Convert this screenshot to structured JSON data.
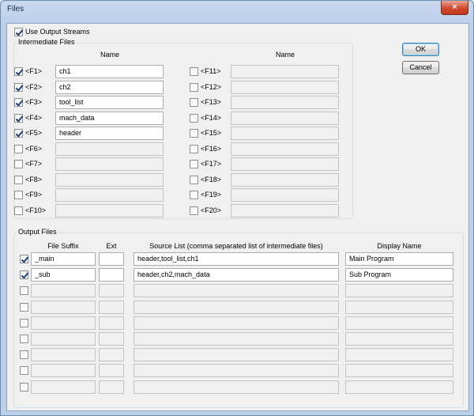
{
  "window": {
    "title": "Files",
    "close_glyph": "×"
  },
  "use_output_streams": {
    "label": "Use Output Streams",
    "checked": true
  },
  "intermediate": {
    "group_title": "Intermediate Files",
    "name_header_left": "Name",
    "name_header_right": "Name",
    "items": [
      {
        "label": "<F1>",
        "value": "ch1",
        "checked": true
      },
      {
        "label": "<F2>",
        "value": "ch2",
        "checked": true
      },
      {
        "label": "<F3>",
        "value": "tool_list",
        "checked": true
      },
      {
        "label": "<F4>",
        "value": "mach_data",
        "checked": true
      },
      {
        "label": "<F5>",
        "value": "header",
        "checked": true
      },
      {
        "label": "<F6>",
        "value": "",
        "checked": false
      },
      {
        "label": "<F7>",
        "value": "",
        "checked": false
      },
      {
        "label": "<F8>",
        "value": "",
        "checked": false
      },
      {
        "label": "<F9>",
        "value": "",
        "checked": false
      },
      {
        "label": "<F10>",
        "value": "",
        "checked": false
      },
      {
        "label": "<F11>",
        "value": "",
        "checked": false
      },
      {
        "label": "<F12>",
        "value": "",
        "checked": false
      },
      {
        "label": "<F13>",
        "value": "",
        "checked": false
      },
      {
        "label": "<F14>",
        "value": "",
        "checked": false
      },
      {
        "label": "<F15>",
        "value": "",
        "checked": false
      },
      {
        "label": "<F16>",
        "value": "",
        "checked": false
      },
      {
        "label": "<F17>",
        "value": "",
        "checked": false
      },
      {
        "label": "<F18>",
        "value": "",
        "checked": false
      },
      {
        "label": "<F19>",
        "value": "",
        "checked": false
      },
      {
        "label": "<F20>",
        "value": "",
        "checked": false
      }
    ]
  },
  "buttons": {
    "ok": "OK",
    "cancel": "Cancel"
  },
  "output": {
    "group_title": "Output Files",
    "headers": {
      "suffix": "File Suffix",
      "ext": "Ext",
      "source": "Source List (comma separated list of intermediate files)",
      "display": "Display Name"
    },
    "rows": [
      {
        "checked": true,
        "suffix": "_main",
        "ext": "",
        "source": "header,tool_list,ch1",
        "display": "Main Program"
      },
      {
        "checked": true,
        "suffix": "_sub",
        "ext": "",
        "source": "header,ch2,mach_data",
        "display": "Sub Program"
      },
      {
        "checked": false,
        "suffix": "",
        "ext": "",
        "source": "",
        "display": ""
      },
      {
        "checked": false,
        "suffix": "",
        "ext": "",
        "source": "",
        "display": ""
      },
      {
        "checked": false,
        "suffix": "",
        "ext": "",
        "source": "",
        "display": ""
      },
      {
        "checked": false,
        "suffix": "",
        "ext": "",
        "source": "",
        "display": ""
      },
      {
        "checked": false,
        "suffix": "",
        "ext": "",
        "source": "",
        "display": ""
      },
      {
        "checked": false,
        "suffix": "",
        "ext": "",
        "source": "",
        "display": ""
      },
      {
        "checked": false,
        "suffix": "",
        "ext": "",
        "source": "",
        "display": ""
      }
    ]
  }
}
